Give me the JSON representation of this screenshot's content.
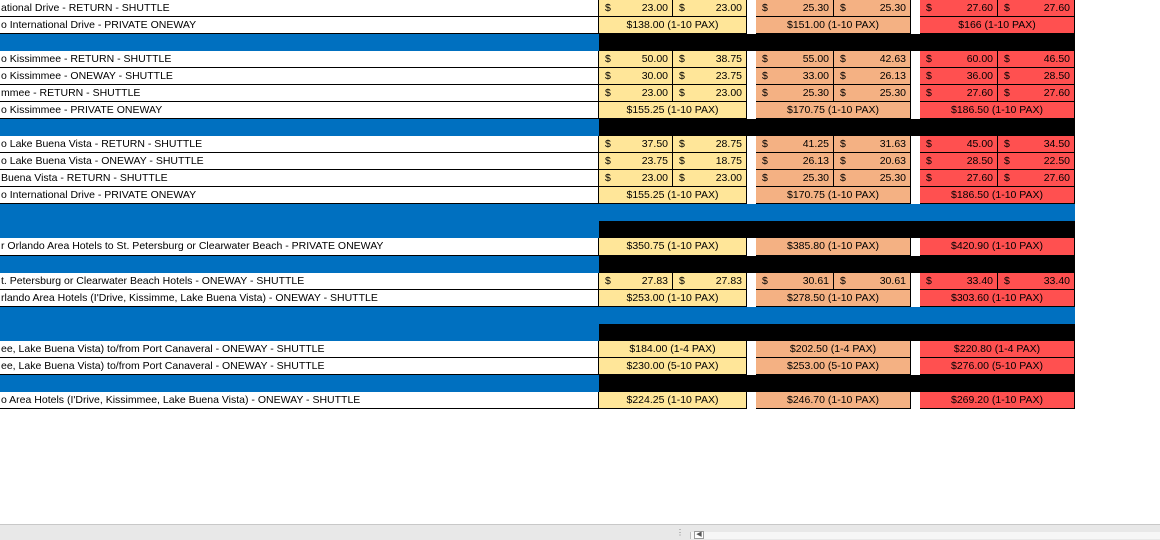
{
  "sheet": {
    "rows": [
      {
        "type": "price",
        "desc": "ational Drive - RETURN - SHUTTLE",
        "cells": [
          [
            "$",
            "23.00",
            "$",
            "23.00"
          ],
          [
            "$",
            "25.30",
            "$",
            "25.30"
          ],
          [
            "$",
            "27.60",
            "$",
            "27.60"
          ]
        ]
      },
      {
        "type": "pax",
        "desc": "o International Drive - PRIVATE ONEWAY",
        "cells": [
          "$138.00 (1-10 PAX)",
          "$151.00 (1-10 PAX)",
          "$166 (1-10 PAX)"
        ]
      },
      {
        "type": "section"
      },
      {
        "type": "price",
        "desc": "o Kissimmee - RETURN - SHUTTLE",
        "cells": [
          [
            "$",
            "50.00",
            "$",
            "38.75"
          ],
          [
            "$",
            "55.00",
            "$",
            "42.63"
          ],
          [
            "$",
            "60.00",
            "$",
            "46.50"
          ]
        ]
      },
      {
        "type": "price",
        "desc": "o Kissimmee - ONEWAY - SHUTTLE",
        "cells": [
          [
            "$",
            "30.00",
            "$",
            "23.75"
          ],
          [
            "$",
            "33.00",
            "$",
            "26.13"
          ],
          [
            "$",
            "36.00",
            "$",
            "28.50"
          ]
        ]
      },
      {
        "type": "price",
        "desc": "mmee - RETURN - SHUTTLE",
        "cells": [
          [
            "$",
            "23.00",
            "$",
            "23.00"
          ],
          [
            "$",
            "25.30",
            "$",
            "25.30"
          ],
          [
            "$",
            "27.60",
            "$",
            "27.60"
          ]
        ]
      },
      {
        "type": "pax",
        "desc": "o Kissimmee - PRIVATE ONEWAY",
        "cells": [
          "$155.25 (1-10 PAX)",
          "$170.75 (1-10 PAX)",
          "$186.50 (1-10 PAX)"
        ]
      },
      {
        "type": "section"
      },
      {
        "type": "price",
        "desc": "o Lake Buena Vista - RETURN - SHUTTLE",
        "cells": [
          [
            "$",
            "37.50",
            "$",
            "28.75"
          ],
          [
            "$",
            "41.25",
            "$",
            "31.63"
          ],
          [
            "$",
            "45.00",
            "$",
            "34.50"
          ]
        ]
      },
      {
        "type": "price",
        "desc": "o Lake Buena Vista - ONEWAY - SHUTTLE",
        "cells": [
          [
            "$",
            "23.75",
            "$",
            "18.75"
          ],
          [
            "$",
            "26.13",
            "$",
            "20.63"
          ],
          [
            "$",
            "28.50",
            "$",
            "22.50"
          ]
        ]
      },
      {
        "type": "price",
        "desc": "Buena Vista - RETURN - SHUTTLE",
        "cells": [
          [
            "$",
            "23.00",
            "$",
            "23.00"
          ],
          [
            "$",
            "25.30",
            "$",
            "25.30"
          ],
          [
            "$",
            "27.60",
            "$",
            "27.60"
          ]
        ]
      },
      {
        "type": "pax",
        "desc": "o International Drive - PRIVATE ONEWAY",
        "cells": [
          "$155.25 (1-10 PAX)",
          "$170.75 (1-10 PAX)",
          "$186.50 (1-10 PAX)"
        ]
      },
      {
        "type": "fullblue"
      },
      {
        "type": "section"
      },
      {
        "type": "pax",
        "tall": true,
        "desc": "r Orlando Area Hotels to St. Petersburg or Clearwater Beach - PRIVATE ONEWAY",
        "cells": [
          "$350.75 (1-10 PAX)",
          "$385.80 (1-10 PAX)",
          "$420.90 (1-10 PAX)"
        ]
      },
      {
        "type": "section"
      },
      {
        "type": "price",
        "desc": "t. Petersburg or Clearwater Beach Hotels - ONEWAY - SHUTTLE",
        "cells": [
          [
            "$",
            "27.83",
            "$",
            "27.83"
          ],
          [
            "$",
            "30.61",
            "$",
            "30.61"
          ],
          [
            "$",
            "33.40",
            "$",
            "33.40"
          ]
        ]
      },
      {
        "type": "pax",
        "desc": "rlando Area Hotels (I'Drive, Kissimme, Lake Buena Vista) - ONEWAY - SHUTTLE",
        "cells": [
          "$253.00 (1-10 PAX)",
          "$278.50 (1-10 PAX)",
          "$303.60 (1-10 PAX)"
        ]
      },
      {
        "type": "fullblue"
      },
      {
        "type": "section"
      },
      {
        "type": "pax",
        "desc": "ee, Lake Buena Vista) to/from Port Canaveral - ONEWAY - SHUTTLE",
        "cells": [
          "$184.00 (1-4 PAX)",
          "$202.50 (1-4 PAX)",
          "$220.80 (1-4 PAX)"
        ]
      },
      {
        "type": "pax",
        "desc": "ee, Lake Buena Vista) to/from Port Canaveral - ONEWAY - SHUTTLE",
        "cells": [
          "$230.00 (5-10 PAX)",
          "$253.00 (5-10 PAX)",
          "$276.00 (5-10 PAX)"
        ]
      },
      {
        "type": "section"
      },
      {
        "type": "pax",
        "desc": "o Area Hotels (I'Drive, Kissimmee, Lake Buena Vista) - ONEWAY - SHUTTLE",
        "cells": [
          "$224.25 (1-10 PAX)",
          "$246.70 (1-10 PAX)",
          "$269.20 (1-10 PAX)"
        ]
      }
    ]
  },
  "colors": {
    "tier1": "#ffe699",
    "tier2": "#f4b183",
    "tier3": "#ff5050",
    "section_blue": "#0070c0",
    "section_black": "#000000"
  },
  "statusbar": {
    "scroll_left_icon": "triangle-left-icon",
    "dots": "⋮"
  }
}
